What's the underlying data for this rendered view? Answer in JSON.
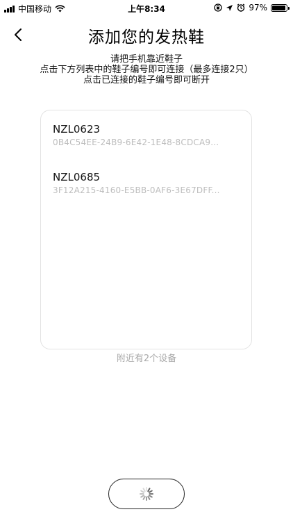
{
  "status_bar": {
    "carrier": "中国移动",
    "time": "上午8:34",
    "battery": "97%",
    "battery_level": 0.97
  },
  "header": {
    "title": "添加您的发热鞋"
  },
  "instructions": [
    "请把手机靠近鞋子",
    "点击下方列表中的鞋子编号即可连接（最多连接2只）",
    "点击已连接的鞋子编号即可断开"
  ],
  "devices": [
    {
      "name": "NZL0623",
      "id": "0B4C54EE-24B9-6E42-1E48-8CDCA9..."
    },
    {
      "name": "NZL0685",
      "id": "3F12A215-4160-E5BB-0AF6-3E67DFF..."
    }
  ],
  "nearby_count_text": "附近有2个设备",
  "icons": {
    "back": "chevron-left-icon",
    "loading": "spinner-icon",
    "wifi": "wifi-icon",
    "signal": "signal-icon",
    "alarm": "alarm-icon",
    "location": "location-icon",
    "lock": "rotation-lock-icon"
  }
}
